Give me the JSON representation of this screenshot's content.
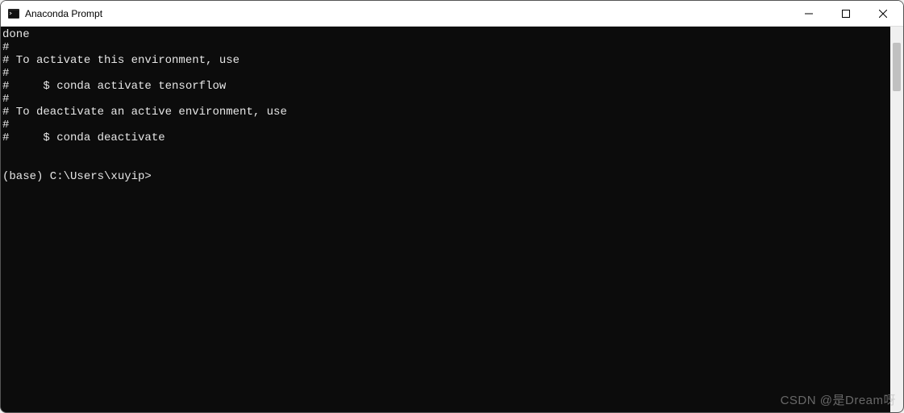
{
  "window": {
    "title": "Anaconda Prompt"
  },
  "terminal": {
    "lines": [
      "done",
      "#",
      "# To activate this environment, use",
      "#",
      "#     $ conda activate tensorflow",
      "#",
      "# To deactivate an active environment, use",
      "#",
      "#     $ conda deactivate",
      "",
      "",
      "(base) C:\\Users\\xuyip>"
    ]
  },
  "watermark": {
    "text": "CSDN @是Dream呀"
  }
}
